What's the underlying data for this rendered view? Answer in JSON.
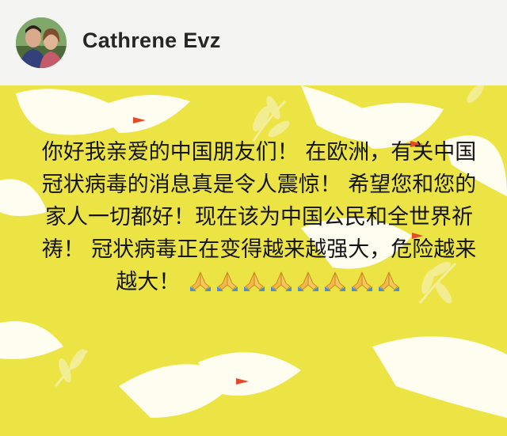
{
  "post": {
    "author": "Cathrene Evz",
    "message": "你好我亲爱的中国朋友们！ 在欧洲，有关中国冠状病毒的消息真是令人震惊！ 希望您和您的家人一切都好！现在该为中国公民和全世界祈祷！ 冠状病毒正在变得越来越强大，危险越来越大！",
    "emoji_icon": "praying-hands",
    "emoji_count": 8,
    "background_color": "#ece444",
    "accent_bird_color": "#ffffff",
    "accent_leaf_color": "#f4ee9a"
  }
}
